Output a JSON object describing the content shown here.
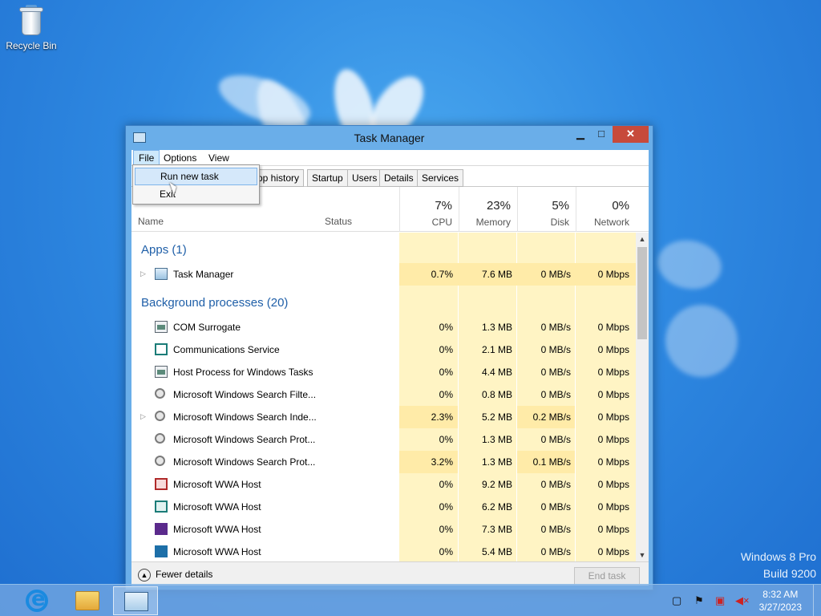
{
  "desktop": {
    "recycle_bin_label": "Recycle Bin",
    "brand_line1": "Windows 8 Pro",
    "brand_line2": "Build 9200"
  },
  "window": {
    "title": "Task Manager",
    "min_glyph": "▁",
    "max_glyph": "□",
    "close_glyph": "✕"
  },
  "menubar": {
    "file": "File",
    "options": "Options",
    "view": "View"
  },
  "file_menu": {
    "run_new_task": "Run new task",
    "exit": "Exit"
  },
  "tabs": [
    "pp history",
    "Startup",
    "Users",
    "Details",
    "Services"
  ],
  "columns": {
    "name": "Name",
    "status": "Status",
    "cpu_pct": "7%",
    "cpu_label": "CPU",
    "mem_pct": "23%",
    "mem_label": "Memory",
    "disk_pct": "5%",
    "disk_label": "Disk",
    "net_pct": "0%",
    "net_label": "Network"
  },
  "groups": {
    "apps": "Apps (1)",
    "background": "Background processes (20)"
  },
  "apps": [
    {
      "name": "Task Manager",
      "icon": "task-manager-icon",
      "cpu": "0.7%",
      "memory": "7.6 MB",
      "disk": "0 MB/s",
      "network": "0 Mbps",
      "expandable": true
    }
  ],
  "processes": [
    {
      "name": "COM Surrogate",
      "icon": "service-icon",
      "cpu": "0%",
      "memory": "1.3 MB",
      "disk": "0 MB/s",
      "network": "0 Mbps"
    },
    {
      "name": "Communications Service",
      "icon": "mail-icon",
      "cpu": "0%",
      "memory": "2.1 MB",
      "disk": "0 MB/s",
      "network": "0 Mbps"
    },
    {
      "name": "Host Process for Windows Tasks",
      "icon": "service-icon",
      "cpu": "0%",
      "memory": "4.4 MB",
      "disk": "0 MB/s",
      "network": "0 Mbps"
    },
    {
      "name": "Microsoft Windows Search Filte...",
      "icon": "search-service-icon",
      "cpu": "0%",
      "memory": "0.8 MB",
      "disk": "0 MB/s",
      "network": "0 Mbps"
    },
    {
      "name": "Microsoft Windows Search Inde...",
      "icon": "search-service-icon",
      "cpu": "2.3%",
      "memory": "5.2 MB",
      "disk": "0.2 MB/s",
      "network": "0 Mbps"
    },
    {
      "name": "Microsoft Windows Search Prot...",
      "icon": "search-service-icon",
      "cpu": "0%",
      "memory": "1.3 MB",
      "disk": "0 MB/s",
      "network": "0 Mbps"
    },
    {
      "name": "Microsoft Windows Search Prot...",
      "icon": "search-service-icon",
      "cpu": "3.2%",
      "memory": "1.3 MB",
      "disk": "0.1 MB/s",
      "network": "0 Mbps"
    },
    {
      "name": "Microsoft WWA Host",
      "icon": "wwa-icon",
      "cpu": "0%",
      "memory": "9.2 MB",
      "disk": "0 MB/s",
      "network": "0 Mbps"
    },
    {
      "name": "Microsoft WWA Host",
      "icon": "wwa-icon",
      "cpu": "0%",
      "memory": "6.2 MB",
      "disk": "0 MB/s",
      "network": "0 Mbps"
    },
    {
      "name": "Microsoft WWA Host",
      "icon": "wwa-icon",
      "cpu": "0%",
      "memory": "7.3 MB",
      "disk": "0 MB/s",
      "network": "0 Mbps"
    },
    {
      "name": "Microsoft WWA Host",
      "icon": "wwa-icon",
      "cpu": "0%",
      "memory": "5.4 MB",
      "disk": "0 MB/s",
      "network": "0 Mbps"
    }
  ],
  "footer": {
    "fewer_details": "Fewer details",
    "end_task": "End task"
  },
  "taskbar": {
    "time": "8:32 AM",
    "date": "3/27/2023"
  },
  "colors": {
    "accent": "#1f5fa8",
    "heat_light": "#fff4c4",
    "heat_dark": "#ffeba8",
    "close_red": "#c74a3b"
  }
}
